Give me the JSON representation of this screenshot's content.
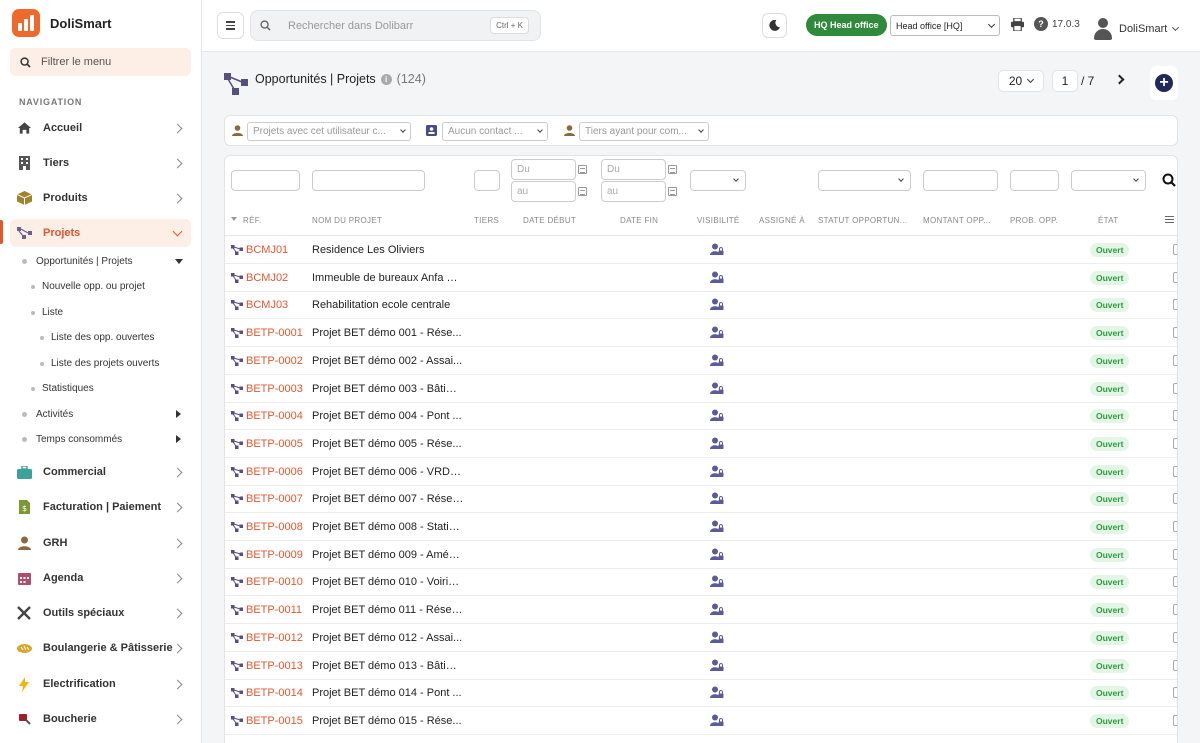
{
  "app": {
    "name": "DoliSmart"
  },
  "sidebar": {
    "filter_placeholder": "Filtrer le menu",
    "nav_title": "NAVIGATION",
    "items": [
      {
        "label": "Accueil",
        "icon": "home-icon"
      },
      {
        "label": "Tiers",
        "icon": "building-icon"
      },
      {
        "label": "Produits",
        "icon": "box-icon"
      },
      {
        "label": "Projets",
        "icon": "project-icon"
      },
      {
        "label": "Commercial",
        "icon": "briefcase-icon"
      },
      {
        "label": "Facturation | Paiement",
        "icon": "invoice-icon"
      },
      {
        "label": "GRH",
        "icon": "user-tie-icon"
      },
      {
        "label": "Agenda",
        "icon": "calendar-icon"
      },
      {
        "label": "Outils spéciaux",
        "icon": "tools-icon"
      },
      {
        "label": "Boulangerie & Pâtisserie",
        "icon": "bread-icon"
      },
      {
        "label": "Electrification",
        "icon": "bolt-icon"
      },
      {
        "label": "Boucherie",
        "icon": "meat-icon"
      }
    ],
    "sub_items": [
      "Opportunités | Projets",
      "Nouvelle opp. ou projet",
      "Liste",
      "Liste des opp. ouvertes",
      "Liste des projets ouverts",
      "Statistiques",
      "Activités",
      "Temps consommés"
    ]
  },
  "topbar": {
    "search_placeholder": "Rechercher dans Dolibarr",
    "shortcut": "Ctrl + K",
    "hq_badge": "HQ Head office",
    "entity": "Head office [HQ]",
    "version": "17.0.3",
    "username": "DoliSmart"
  },
  "page": {
    "title": "Opportunités | Projets",
    "count": "(124)",
    "per_page": "20",
    "current_page": "1",
    "total_pages": "/ 7"
  },
  "filters": {
    "user_placeholder": "Projets avec cet utilisateur c...",
    "contact_placeholder": "Aucun contact ...",
    "thirdparty_placeholder": "Tiers ayant pour com..."
  },
  "table": {
    "date_from": "Du",
    "date_to": "au",
    "headers": [
      "RÉF.",
      "NOM DU PROJET",
      "TIERS",
      "DATE DÉBUT",
      "DATE FIN",
      "VISIBILITÉ",
      "ASSIGNÉ À",
      "STATUT OPPORTUN...",
      "MONTANT OPP...",
      "PROB. OPP.",
      "ÉTAT"
    ],
    "rows": [
      {
        "ref": "BCMJ01",
        "name": "Residence Les Oliviers",
        "status": "Ouvert"
      },
      {
        "ref": "BCMJ02",
        "name": "Immeuble de bureaux Anfa Pl...",
        "status": "Ouvert"
      },
      {
        "ref": "BCMJ03",
        "name": "Rehabilitation ecole centrale",
        "status": "Ouvert"
      },
      {
        "ref": "BETP-0001",
        "name": "Projet BET démo 001 - Rése...",
        "status": "Ouvert"
      },
      {
        "ref": "BETP-0002",
        "name": "Projet BET démo 002 - Assai...",
        "status": "Ouvert"
      },
      {
        "ref": "BETP-0003",
        "name": "Projet BET démo 003 - Bâtim...",
        "status": "Ouvert"
      },
      {
        "ref": "BETP-0004",
        "name": "Projet BET démo 004 - Pont ...",
        "status": "Ouvert"
      },
      {
        "ref": "BETP-0005",
        "name": "Projet BET démo 005 - Rése...",
        "status": "Ouvert"
      },
      {
        "ref": "BETP-0006",
        "name": "Projet BET démo 006 - VRD I...",
        "status": "Ouvert"
      },
      {
        "ref": "BETP-0007",
        "name": "Projet BET démo 007 - Réser...",
        "status": "Ouvert"
      },
      {
        "ref": "BETP-0008",
        "name": "Projet BET démo 008 - Statio...",
        "status": "Ouvert"
      },
      {
        "ref": "BETP-0009",
        "name": "Projet BET démo 009 - Amén...",
        "status": "Ouvert"
      },
      {
        "ref": "BETP-0010",
        "name": "Projet BET démo 010 - Voirie ...",
        "status": "Ouvert"
      },
      {
        "ref": "BETP-0011",
        "name": "Projet BET démo 011 - Résea...",
        "status": "Ouvert"
      },
      {
        "ref": "BETP-0012",
        "name": "Projet BET démo 012 - Assai...",
        "status": "Ouvert"
      },
      {
        "ref": "BETP-0013",
        "name": "Projet BET démo 013 - Bâtim...",
        "status": "Ouvert"
      },
      {
        "ref": "BETP-0014",
        "name": "Projet BET démo 014 - Pont ...",
        "status": "Ouvert"
      },
      {
        "ref": "BETP-0015",
        "name": "Projet BET démo 015 - Rése...",
        "status": "Ouvert"
      }
    ]
  },
  "colors": {
    "accent": "#e4572e",
    "brand": "#ee6a2c",
    "status_open": "#2f9a3e",
    "hq_badge": "#2f8a3b"
  }
}
